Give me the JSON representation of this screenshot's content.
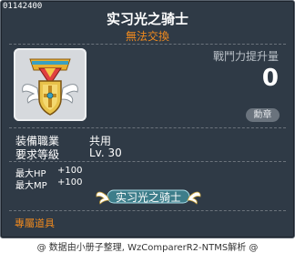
{
  "tooltip": {
    "item_id": "01142400",
    "item_name": "实习光之骑士",
    "subtitle": "無法交換",
    "stat_label": "戰鬥力提升量",
    "stat_value": "0",
    "medal_button": "勳章",
    "icon": "knight-medal-icon",
    "requirements": [
      {
        "label": "装備職業",
        "value": "共用"
      },
      {
        "label": "要求等級",
        "value": "Lv. 30"
      }
    ],
    "stats": [
      {
        "label": "最大HP",
        "value": "+100"
      },
      {
        "label": "最大MP",
        "value": "+100"
      }
    ],
    "medal_tag_text": "实习光之骑士",
    "exclusive_label": "專屬道具"
  },
  "footer": {
    "credit": "@ 数据由小册子整理, WzComparerR2-NTMS解析 @"
  },
  "colors": {
    "panel": "#2f3a46",
    "accent_orange": "#f08a1e",
    "medal_teal": "#3d7d8a"
  }
}
